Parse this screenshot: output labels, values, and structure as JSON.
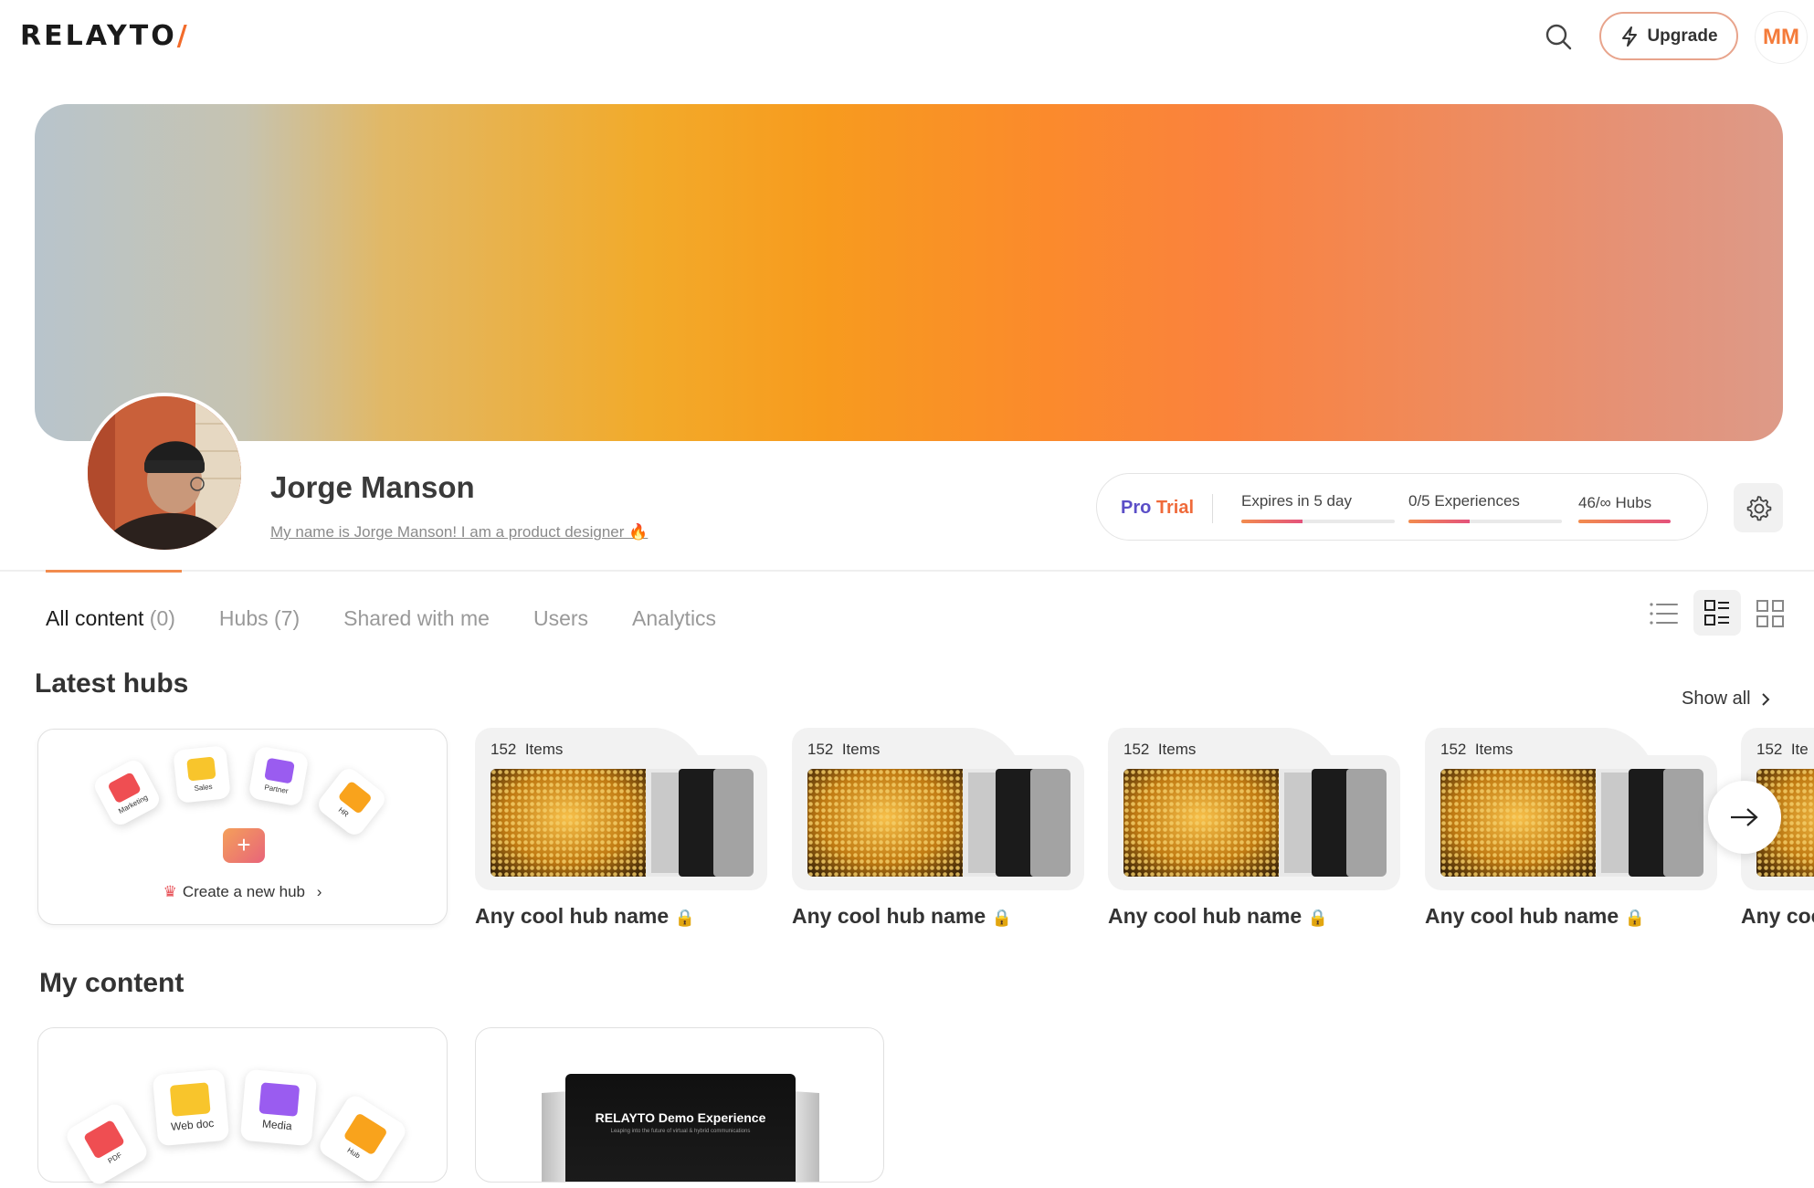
{
  "header": {
    "logo_text": "RELAYTO",
    "logo_slash": "/",
    "upgrade_label": "Upgrade",
    "user_initials": "MM"
  },
  "profile": {
    "name": "Jorge Manson",
    "bio": "My name is Jorge Manson! I am a product designer 🔥"
  },
  "plan": {
    "plan_pro": "Pro",
    "plan_trial": "Trial",
    "stats": [
      {
        "label": "Expires in 5 day",
        "progress": 0.4
      },
      {
        "label": "0/5 Experiences",
        "progress": 0.4
      },
      {
        "label": "46/∞ Hubs",
        "progress": 1.0
      }
    ]
  },
  "tabs": [
    {
      "label": "All content",
      "count": "(0)",
      "active": true
    },
    {
      "label": "Hubs",
      "count": "(7)",
      "active": false
    },
    {
      "label": "Shared with me",
      "count": "",
      "active": false
    },
    {
      "label": "Users",
      "count": "",
      "active": false
    },
    {
      "label": "Analytics",
      "count": "",
      "active": false
    }
  ],
  "latest_hubs": {
    "title": "Latest hubs",
    "show_all": "Show all",
    "create": {
      "label": "Create a new hub",
      "tiles": [
        "Marketing",
        "Sales",
        "Partner",
        "HR"
      ]
    },
    "hubs": [
      {
        "count": "152",
        "items_label": "Items",
        "name": "Any cool hub name"
      },
      {
        "count": "152",
        "items_label": "Items",
        "name": "Any cool hub name"
      },
      {
        "count": "152",
        "items_label": "Items",
        "name": "Any cool hub name"
      },
      {
        "count": "152",
        "items_label": "Items",
        "name": "Any cool hub name"
      },
      {
        "count": "152",
        "items_label": "Ite",
        "name": "Any coo"
      }
    ]
  },
  "my_content": {
    "title": "My content",
    "tiles": [
      "PDF",
      "Web doc",
      "Media",
      "Hub"
    ],
    "demo_title": "RELAYTO Demo Experience",
    "demo_subtitle": "Leaping into the future of virtual & hybrid communications"
  },
  "colors": {
    "accent": "#f26b2a",
    "pro": "#5b4ec7",
    "trial": "#ef6a3a"
  }
}
